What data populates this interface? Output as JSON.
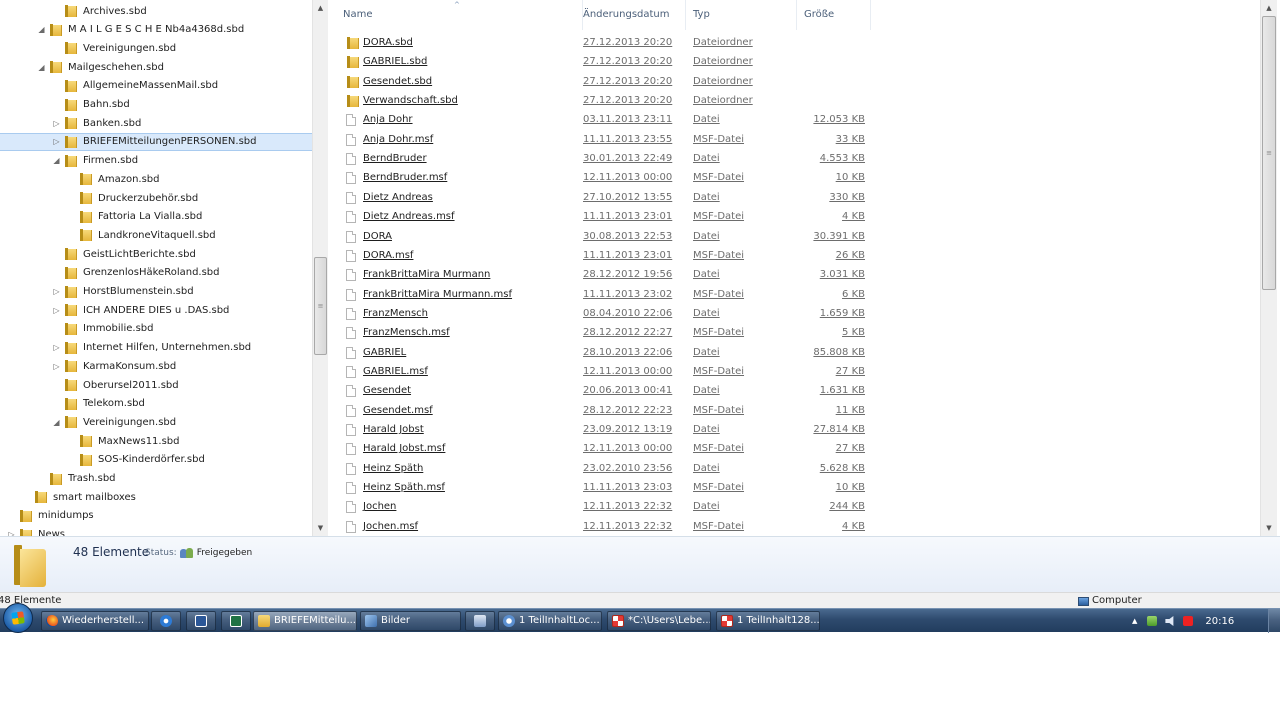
{
  "tree": {
    "items": [
      {
        "label": "Archives.sbd",
        "indent": 4,
        "arrow": "none"
      },
      {
        "label": "M A I L G E S C H E Nb4a4368d.sbd",
        "indent": 3,
        "arrow": "expanded"
      },
      {
        "label": "Vereinigungen.sbd",
        "indent": 4,
        "arrow": "none"
      },
      {
        "label": "Mailgeschehen.sbd",
        "indent": 3,
        "arrow": "expanded"
      },
      {
        "label": "AllgemeineMassenMail.sbd",
        "indent": 4,
        "arrow": "none"
      },
      {
        "label": "Bahn.sbd",
        "indent": 4,
        "arrow": "none"
      },
      {
        "label": "Banken.sbd",
        "indent": 4,
        "arrow": "collapsed"
      },
      {
        "label": "BRIEFEMitteilungenPERSONEN.sbd",
        "indent": 4,
        "arrow": "collapsed",
        "selected": true
      },
      {
        "label": "Firmen.sbd",
        "indent": 4,
        "arrow": "expanded"
      },
      {
        "label": "Amazon.sbd",
        "indent": 5,
        "arrow": "none"
      },
      {
        "label": "Druckerzubehör.sbd",
        "indent": 5,
        "arrow": "none"
      },
      {
        "label": "Fattoria La Vialla.sbd",
        "indent": 5,
        "arrow": "none"
      },
      {
        "label": "LandkroneVitaquell.sbd",
        "indent": 5,
        "arrow": "none"
      },
      {
        "label": "GeistLichtBerichte.sbd",
        "indent": 4,
        "arrow": "none"
      },
      {
        "label": "GrenzenlosHäkeRoland.sbd",
        "indent": 4,
        "arrow": "none"
      },
      {
        "label": "HorstBlumenstein.sbd",
        "indent": 4,
        "arrow": "collapsed"
      },
      {
        "label": "ICH ANDERE DIES u .DAS.sbd",
        "indent": 4,
        "arrow": "collapsed"
      },
      {
        "label": "Immobilie.sbd",
        "indent": 4,
        "arrow": "none"
      },
      {
        "label": "Internet Hilfen, Unternehmen.sbd",
        "indent": 4,
        "arrow": "collapsed"
      },
      {
        "label": "KarmaKonsum.sbd",
        "indent": 4,
        "arrow": "collapsed"
      },
      {
        "label": "Oberursel2011.sbd",
        "indent": 4,
        "arrow": "none"
      },
      {
        "label": "Telekom.sbd",
        "indent": 4,
        "arrow": "none"
      },
      {
        "label": "Vereinigungen.sbd",
        "indent": 4,
        "arrow": "expanded"
      },
      {
        "label": "MaxNews11.sbd",
        "indent": 5,
        "arrow": "none"
      },
      {
        "label": "SOS-Kinderdörfer.sbd",
        "indent": 5,
        "arrow": "none"
      },
      {
        "label": "Trash.sbd",
        "indent": 3,
        "arrow": "none"
      },
      {
        "label": "smart mailboxes",
        "indent": 2,
        "arrow": "none"
      },
      {
        "label": "minidumps",
        "indent": 1,
        "arrow": "none"
      },
      {
        "label": "News",
        "indent": 1,
        "arrow": "collapsed"
      }
    ]
  },
  "columns": {
    "name": "Name",
    "date": "Änderungsdatum",
    "type": "Typ",
    "size": "Größe"
  },
  "files": [
    {
      "name": "DORA.sbd",
      "date": "27.12.2013 20:20",
      "type": "Dateiordner",
      "size": "",
      "kind": "folder"
    },
    {
      "name": "GABRIEL.sbd",
      "date": "27.12.2013 20:20",
      "type": "Dateiordner",
      "size": "",
      "kind": "folder"
    },
    {
      "name": "Gesendet.sbd",
      "date": "27.12.2013 20:20",
      "type": "Dateiordner",
      "size": "",
      "kind": "folder"
    },
    {
      "name": "Verwandschaft.sbd",
      "date": "27.12.2013 20:20",
      "type": "Dateiordner",
      "size": "",
      "kind": "folder"
    },
    {
      "name": "Anja Dohr",
      "date": "03.11.2013 23:11",
      "type": "Datei",
      "size": "12.053 KB",
      "kind": "file"
    },
    {
      "name": "Anja Dohr.msf",
      "date": "11.11.2013 23:55",
      "type": "MSF-Datei",
      "size": "33 KB",
      "kind": "file"
    },
    {
      "name": "BerndBruder",
      "date": "30.01.2013 22:49",
      "type": "Datei",
      "size": "4.553 KB",
      "kind": "file"
    },
    {
      "name": "BerndBruder.msf",
      "date": "12.11.2013 00:00",
      "type": "MSF-Datei",
      "size": "10 KB",
      "kind": "file"
    },
    {
      "name": "Dietz Andreas",
      "date": "27.10.2012 13:55",
      "type": "Datei",
      "size": "330 KB",
      "kind": "file"
    },
    {
      "name": "Dietz Andreas.msf",
      "date": "11.11.2013 23:01",
      "type": "MSF-Datei",
      "size": "4 KB",
      "kind": "file"
    },
    {
      "name": "DORA",
      "date": "30.08.2013 22:53",
      "type": "Datei",
      "size": "30.391 KB",
      "kind": "file"
    },
    {
      "name": "DORA.msf",
      "date": "11.11.2013 23:01",
      "type": "MSF-Datei",
      "size": "26 KB",
      "kind": "file"
    },
    {
      "name": "FrankBrittaMira Murmann",
      "date": "28.12.2012 19:56",
      "type": "Datei",
      "size": "3.031 KB",
      "kind": "file"
    },
    {
      "name": "FrankBrittaMira Murmann.msf",
      "date": "11.11.2013 23:02",
      "type": "MSF-Datei",
      "size": "6 KB",
      "kind": "file"
    },
    {
      "name": "FranzMensch",
      "date": "08.04.2010 22:06",
      "type": "Datei",
      "size": "1.659 KB",
      "kind": "file"
    },
    {
      "name": "FranzMensch.msf",
      "date": "28.12.2012 22:27",
      "type": "MSF-Datei",
      "size": "5 KB",
      "kind": "file"
    },
    {
      "name": "GABRIEL",
      "date": "28.10.2013 22:06",
      "type": "Datei",
      "size": "85.808 KB",
      "kind": "file"
    },
    {
      "name": "GABRIEL.msf",
      "date": "12.11.2013 00:00",
      "type": "MSF-Datei",
      "size": "27 KB",
      "kind": "file"
    },
    {
      "name": "Gesendet",
      "date": "20.06.2013 00:41",
      "type": "Datei",
      "size": "1.631 KB",
      "kind": "file"
    },
    {
      "name": "Gesendet.msf",
      "date": "28.12.2012 22:23",
      "type": "MSF-Datei",
      "size": "11 KB",
      "kind": "file"
    },
    {
      "name": "Harald Jobst",
      "date": "23.09.2012 13:19",
      "type": "Datei",
      "size": "27.814 KB",
      "kind": "file"
    },
    {
      "name": "Harald Jobst.msf",
      "date": "12.11.2013 00:00",
      "type": "MSF-Datei",
      "size": "27 KB",
      "kind": "file"
    },
    {
      "name": "Heinz Späth",
      "date": "23.02.2010 23:56",
      "type": "Datei",
      "size": "5.628 KB",
      "kind": "file"
    },
    {
      "name": "Heinz Späth.msf",
      "date": "11.11.2013 23:03",
      "type": "MSF-Datei",
      "size": "10 KB",
      "kind": "file"
    },
    {
      "name": "Jochen",
      "date": "12.11.2013 22:32",
      "type": "Datei",
      "size": "244 KB",
      "kind": "file"
    },
    {
      "name": "Jochen.msf",
      "date": "12.11.2013 22:32",
      "type": "MSF-Datei",
      "size": "4 KB",
      "kind": "file"
    }
  ],
  "details": {
    "count": "48 Elemente",
    "status_label": "Status:",
    "status_value": "Freigegeben"
  },
  "statusbar": {
    "left": "48 Elemente",
    "right": "Computer"
  },
  "taskbar": {
    "items": [
      {
        "label": "Wiederherstell...",
        "icon": "firefox",
        "kind": "app"
      },
      {
        "label": "",
        "icon": "ie",
        "kind": "pinned"
      },
      {
        "label": "",
        "icon": "word",
        "kind": "pinned"
      },
      {
        "label": "",
        "icon": "excel",
        "kind": "pinned"
      },
      {
        "label": "BRIEFEMitteilu...",
        "icon": "folder",
        "kind": "app",
        "active": true
      },
      {
        "label": "Bilder",
        "icon": "photo",
        "kind": "app"
      },
      {
        "label": "",
        "icon": "note",
        "kind": "pinned"
      },
      {
        "label": "1 TeilInhaltLoc...",
        "icon": "doc",
        "kind": "app"
      },
      {
        "label": "*C:\\Users\\Lebe...",
        "icon": "red",
        "kind": "app"
      },
      {
        "label": "1 TeilInhalt128...",
        "icon": "red",
        "kind": "app"
      }
    ],
    "clock": "20:16"
  }
}
